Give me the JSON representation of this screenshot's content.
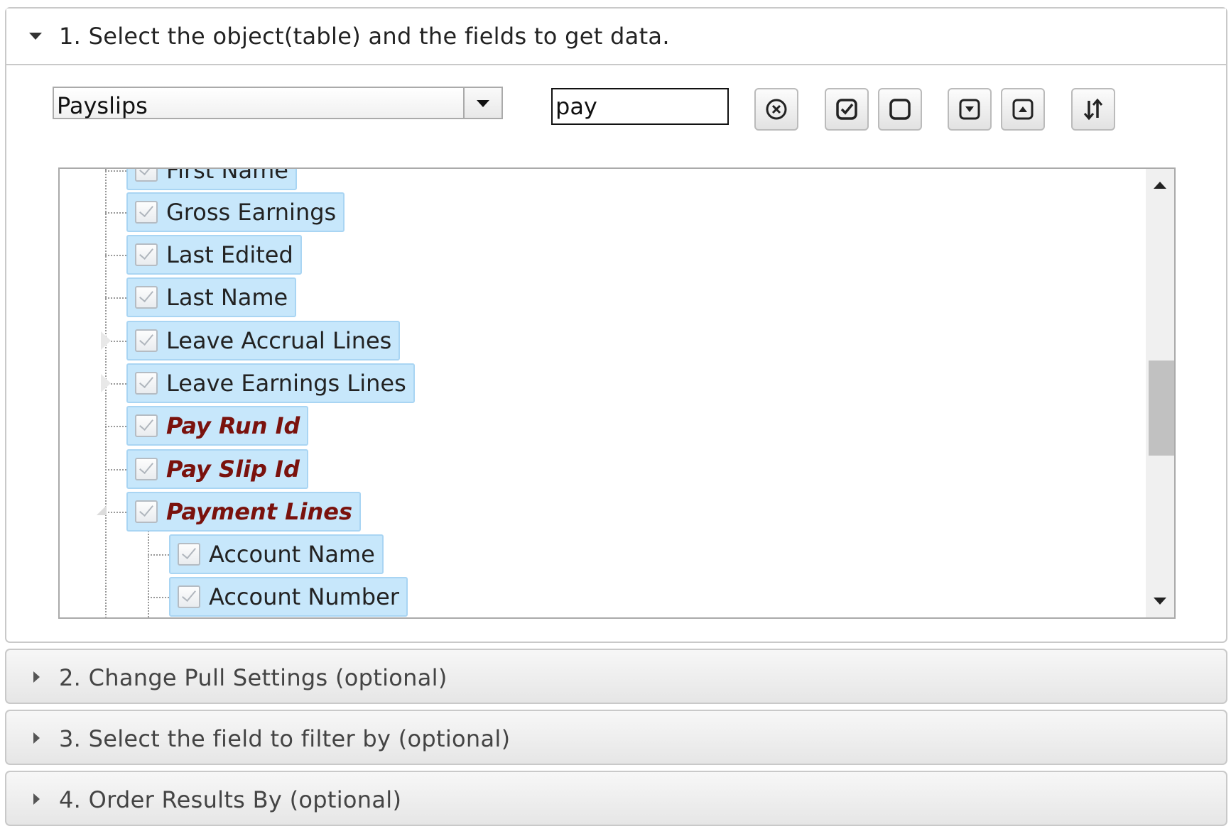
{
  "sections": [
    {
      "title": "1. Select the object(table) and the fields to get data.",
      "expanded": true
    },
    {
      "title": "2. Change Pull Settings (optional)",
      "expanded": false
    },
    {
      "title": "3. Select the field to filter by (optional)",
      "expanded": false
    },
    {
      "title": "4. Order Results By (optional)",
      "expanded": false
    }
  ],
  "object_select": {
    "value": "Payslips"
  },
  "search": {
    "value": "pay"
  },
  "toolbar": {
    "icons": [
      "clear-icon",
      "check-all-icon",
      "uncheck-all-icon",
      "expand-all-icon",
      "collapse-all-icon",
      "sort-icon"
    ]
  },
  "tree": {
    "nodes": [
      {
        "label": "First Name",
        "checked": true,
        "highlight": false
      },
      {
        "label": "Gross Earnings",
        "checked": true,
        "highlight": false
      },
      {
        "label": "Last Edited",
        "checked": true,
        "highlight": false
      },
      {
        "label": "Last Name",
        "checked": true,
        "highlight": false
      },
      {
        "label": "Leave Accrual Lines",
        "checked": true,
        "highlight": false,
        "expandable": true,
        "expanded": false
      },
      {
        "label": "Leave Earnings Lines",
        "checked": true,
        "highlight": false,
        "expandable": true,
        "expanded": false
      },
      {
        "label": "Pay Run Id",
        "checked": true,
        "highlight": true
      },
      {
        "label": "Pay Slip Id",
        "checked": true,
        "highlight": true
      },
      {
        "label": "Payment Lines",
        "checked": true,
        "highlight": true,
        "expandable": true,
        "expanded": true
      },
      {
        "label": "Account Name",
        "checked": true,
        "highlight": false,
        "level": 2
      },
      {
        "label": "Account Number",
        "checked": true,
        "highlight": false,
        "level": 2
      }
    ]
  },
  "colors": {
    "node_bg": "#c7e7fb",
    "node_border": "#a9d5f3",
    "highlight_text": "#7a120d",
    "panel_border": "#c9c9c9"
  }
}
